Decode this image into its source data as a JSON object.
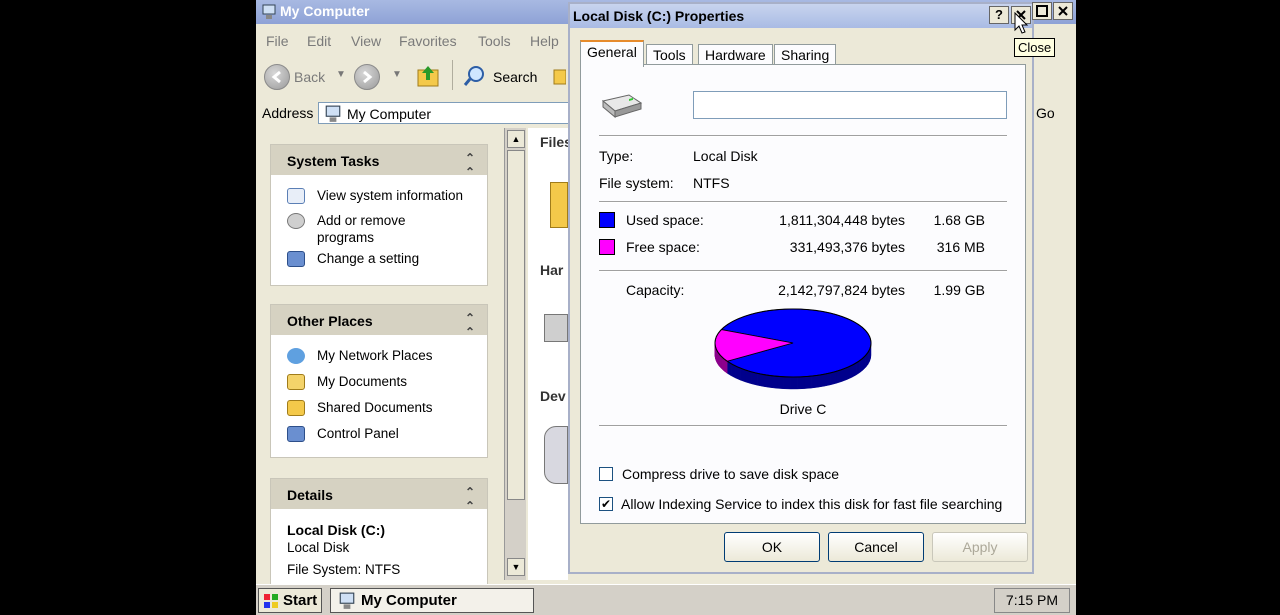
{
  "explorer": {
    "title": "My Computer",
    "menu": [
      "File",
      "Edit",
      "View",
      "Favorites",
      "Tools",
      "Help"
    ],
    "toolbar": {
      "back_label": "Back",
      "search_label": "Search"
    },
    "address": {
      "label": "Address",
      "value": "My Computer",
      "go_label": "Go"
    },
    "taskpane": {
      "system_tasks": {
        "title": "System Tasks",
        "items": [
          "View system information",
          "Add or remove programs",
          "Change a setting"
        ]
      },
      "other_places": {
        "title": "Other Places",
        "items": [
          "My Network Places",
          "My Documents",
          "Shared Documents",
          "Control Panel"
        ]
      },
      "details": {
        "title": "Details",
        "name": "Local Disk (C:)",
        "type": "Local Disk",
        "file_system": "File System: NTFS"
      }
    },
    "content_partial_labels": [
      "Files",
      "Har",
      "Dev"
    ]
  },
  "dialog": {
    "title": "Local Disk (C:) Properties",
    "help_label": "?",
    "tooltip": "Close",
    "tabs": [
      "General",
      "Tools",
      "Hardware",
      "Sharing"
    ],
    "active_tab": "General",
    "name_value": "",
    "type_label": "Type:",
    "type_value": "Local Disk",
    "fs_label": "File system:",
    "fs_value": "NTFS",
    "used": {
      "label": "Used space:",
      "bytes": "1,811,304,448 bytes",
      "size": "1.68 GB",
      "color": "#0000ff"
    },
    "free": {
      "label": "Free space:",
      "bytes": "331,493,376 bytes",
      "size": "316 MB",
      "color": "#ff00ff"
    },
    "capacity": {
      "label": "Capacity:",
      "bytes": "2,142,797,824 bytes",
      "size": "1.99 GB"
    },
    "drive_label": "Drive C",
    "compress_label": "Compress drive to save disk space",
    "compress_checked": false,
    "index_label": "Allow Indexing Service to index this disk for fast file searching",
    "index_checked": true,
    "buttons": {
      "ok": "OK",
      "cancel": "Cancel",
      "apply": "Apply"
    }
  },
  "taskbar": {
    "start_label": "Start",
    "task_label": "My Computer",
    "clock": "7:15 PM"
  }
}
